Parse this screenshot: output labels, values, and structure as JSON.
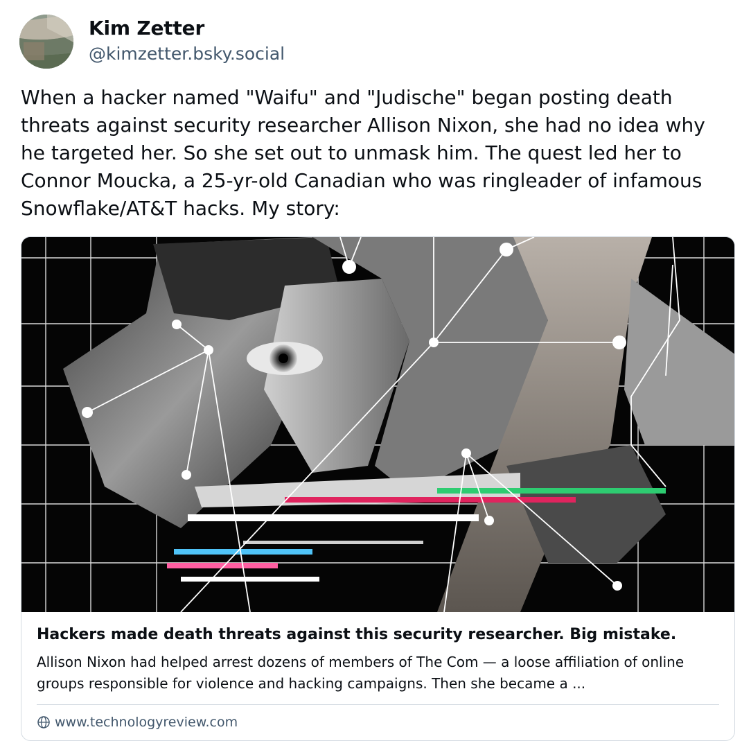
{
  "author": {
    "name": "Kim Zetter",
    "handle": "@kimzetter.bsky.social",
    "avatar_icon": "avatar-photo"
  },
  "post": {
    "text": "When a hacker named \"Waifu\" and \"Judische\" began posting death threats against security researcher Allison Nixon, she had no idea why he targeted her. So she set out to unmask him. The quest led her to Connor Moucka, a 25-yr-old Canadian who was ringleader of infamous Snowflake/AT&T hacks. My story:"
  },
  "link_card": {
    "title": "Hackers made death threats against this security researcher. Big mistake.",
    "description": "Allison Nixon had helped arrest dozens of members of The Com — a loose affiliation of online groups responsible for violence and hacking campaigns. Then she became a ...",
    "domain": "www.technologyreview.com",
    "domain_icon": "globe-icon",
    "image_icon": "collage-face-network-image"
  },
  "colors": {
    "text_primary": "#0b0f14",
    "text_secondary": "#42576c",
    "border": "#d4dbe2"
  }
}
